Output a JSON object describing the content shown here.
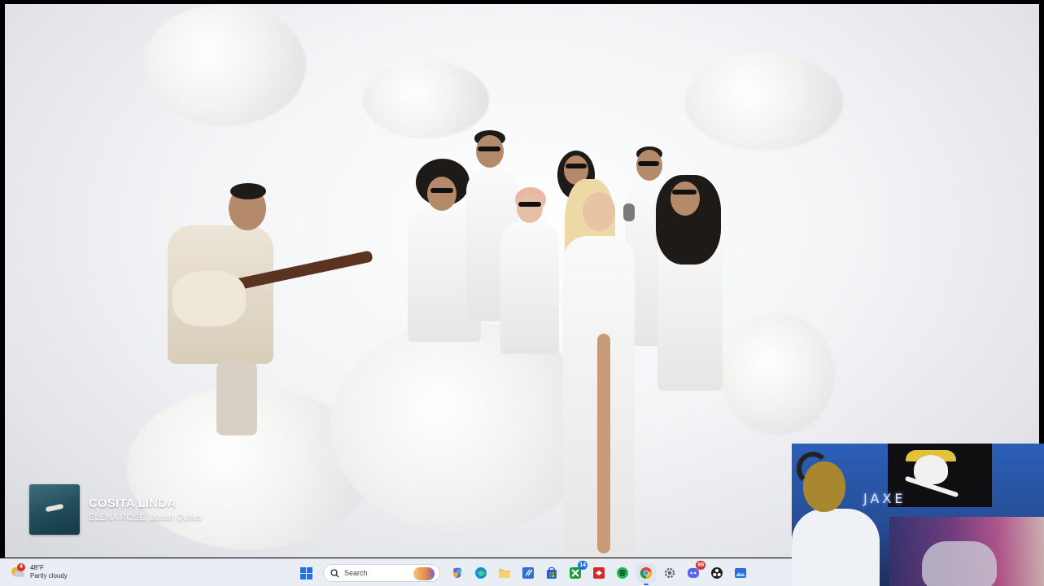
{
  "now_playing": {
    "title": "COSITA LINDA",
    "artists": "ELENA ROSE, Justin Quiles",
    "album_art_icon": "album-cover-swimmer-icon"
  },
  "taskbar": {
    "weather": {
      "temp": "48°F",
      "condition": "Partly cloudy",
      "badge": "4",
      "icon": "partly-cloudy-icon"
    },
    "search": {
      "placeholder": "Search"
    },
    "apps": [
      {
        "name": "start-button",
        "icon": "windows-icon"
      },
      {
        "name": "copilot",
        "icon": "copilot-icon",
        "color": "#7b5ad6"
      },
      {
        "name": "edge",
        "icon": "edge-icon",
        "color": "#1b8ad6"
      },
      {
        "name": "file-explorer",
        "icon": "folder-icon",
        "color": "#f2c14e"
      },
      {
        "name": "visual-studio-code",
        "icon": "code-editor-icon",
        "color": "#2f6fd6"
      },
      {
        "name": "microsoft-store",
        "icon": "store-icon",
        "color": "#2864c8"
      },
      {
        "name": "xbox",
        "icon": "xbox-icon",
        "color": "#1f9a3a",
        "badge": "14"
      },
      {
        "name": "recorder",
        "icon": "record-icon",
        "color": "#d42a2a"
      },
      {
        "name": "spotify",
        "icon": "spotify-icon",
        "color": "#1db954"
      },
      {
        "name": "chrome",
        "icon": "chrome-icon",
        "active": true
      },
      {
        "name": "settings",
        "icon": "gear-icon",
        "color": "#5a5f66"
      },
      {
        "name": "discord",
        "icon": "discord-icon",
        "color": "#5865f2",
        "badge": "99"
      },
      {
        "name": "obs",
        "icon": "obs-icon",
        "color": "#222222"
      },
      {
        "name": "photos",
        "icon": "photos-icon",
        "color": "#2b6ed6"
      }
    ]
  },
  "webcam": {
    "neon_sign": "JAXE"
  }
}
